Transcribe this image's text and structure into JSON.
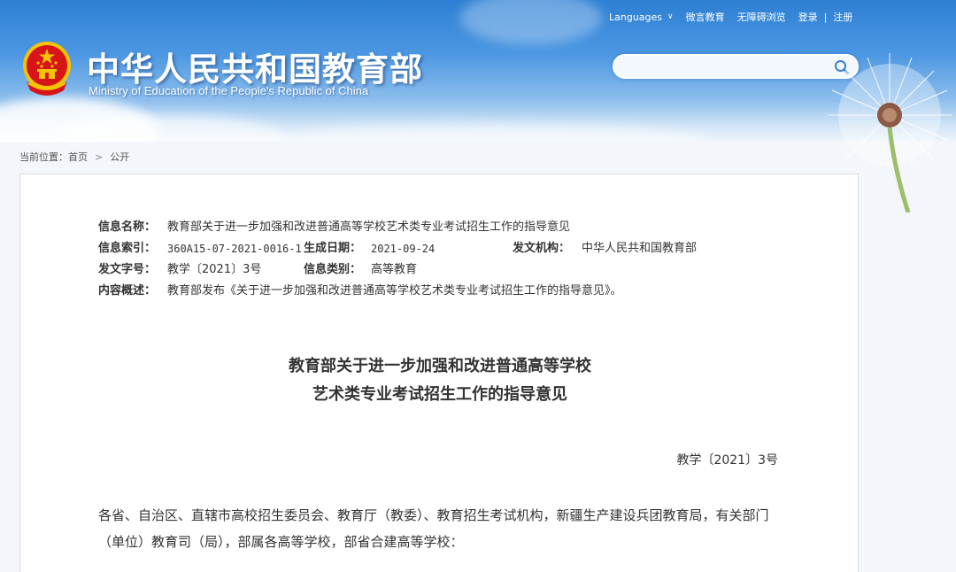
{
  "header": {
    "title_cn": "中华人民共和国教育部",
    "title_en": "Ministry of Education of the People's Republic of China",
    "links": {
      "languages": "Languages",
      "wechat": "微言教育",
      "accessibility": "无障碍浏览",
      "login": "登录",
      "separator": "|",
      "register": "注册"
    },
    "search": {
      "placeholder": ""
    }
  },
  "breadcrumb": {
    "prefix": "当前位置：",
    "home": "首页",
    "arrow": ">",
    "current": "公开"
  },
  "meta": {
    "name_label": "信息名称：",
    "name_value": "教育部关于进一步加强和改进普通高等学校艺术类专业考试招生工作的指导意见",
    "index_label": "信息索引：",
    "index_value": "360A15-07-2021-0016-1",
    "date_label": "生成日期：",
    "date_value": "2021-09-24",
    "issuer_label": "发文机构：",
    "issuer_value": "中华人民共和国教育部",
    "docno_label": "发文字号：",
    "docno_value": "教学〔2021〕3号",
    "category_label": "信息类别：",
    "category_value": "高等教育",
    "summary_label": "内容概述：",
    "summary_value": "教育部发布《关于进一步加强和改进普通高等学校艺术类专业考试招生工作的指导意见》。"
  },
  "document": {
    "title_line1": "教育部关于进一步加强和改进普通高等学校",
    "title_line2": "艺术类专业考试招生工作的指导意见",
    "number": "教学〔2021〕3号",
    "addressee": "各省、自治区、直辖市高校招生委员会、教育厅（教委）、教育招生考试机构，新疆生产建设兵团教育局，有关部门（单位）教育司（局），部属各高等学校，部省合建高等学校："
  },
  "colors": {
    "header_blue": "#2d7fd3",
    "emblem_red": "#d7141a",
    "emblem_gold": "#f5c400"
  }
}
